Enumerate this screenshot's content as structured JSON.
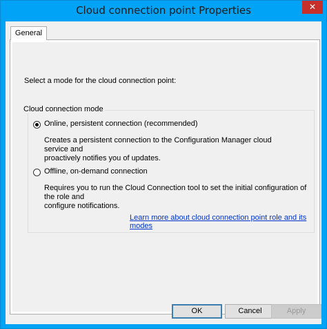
{
  "window": {
    "title": "Cloud connection point Properties",
    "close_label": "✕"
  },
  "tabs": [
    {
      "label": "General",
      "selected": true
    }
  ],
  "general": {
    "select_mode_label": "Select a mode for the cloud connection point:",
    "group_title": "Cloud connection mode",
    "options": [
      {
        "label": "Online, persistent connection (recommended)",
        "selected": true,
        "description_line1": "Creates a persistent connection to the Configuration Manager cloud service and",
        "description_line2": "proactively notifies you of updates."
      },
      {
        "label": "Offline, on-demand connection",
        "selected": false,
        "description_line1": "Requires you to run the Cloud Connection tool to set the initial configuration of the role and",
        "description_line2": "configure notifications."
      }
    ],
    "learn_more_link": "Learn more about cloud connection point role and its modes"
  },
  "buttons": {
    "ok": "OK",
    "cancel": "Cancel",
    "apply": "Apply"
  },
  "colors": {
    "title_bar": "#00a3f5",
    "close_button": "#c7302a",
    "link": "#0033cc"
  }
}
